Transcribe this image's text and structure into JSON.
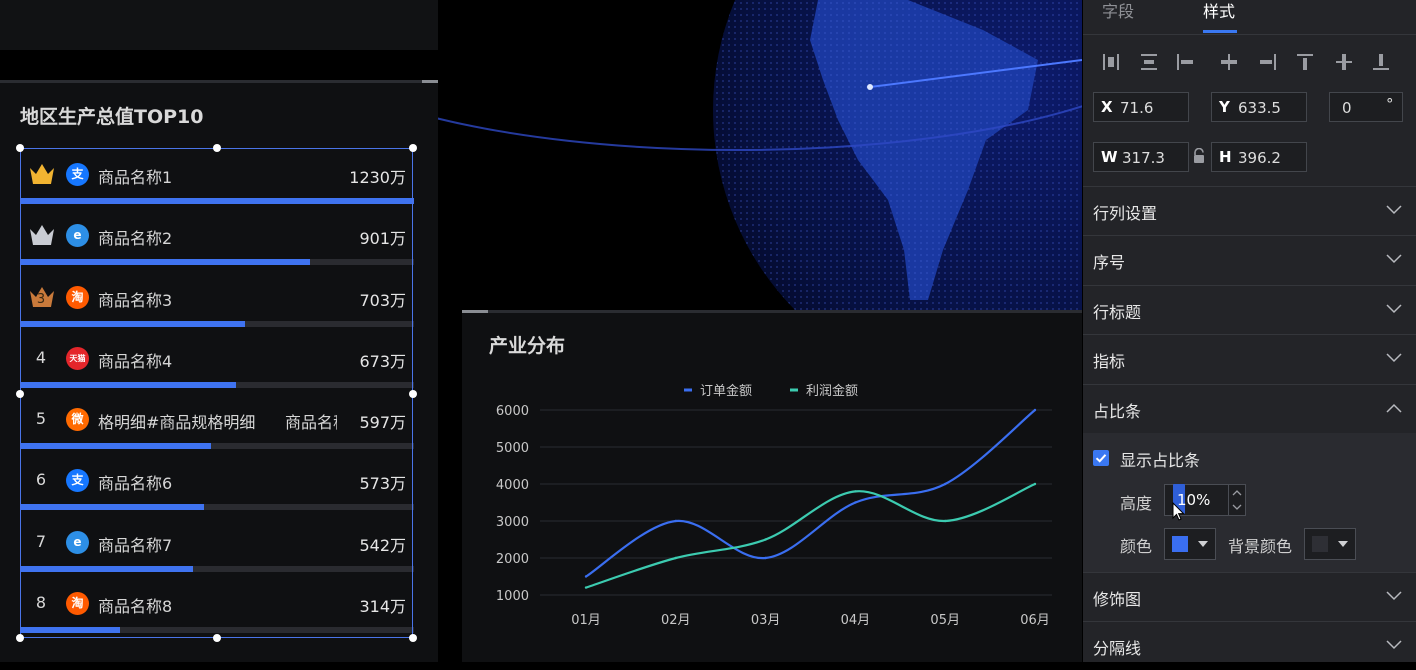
{
  "rank_panel": {
    "title": "地区生产总值TOP10",
    "rows": [
      {
        "rank": "",
        "icon": "alipay-icon",
        "icon_text": "支",
        "icon_color": "#1677ff",
        "crown": "gold",
        "name": "商品名称1",
        "extra": "",
        "value": "1230万",
        "ratio": 1.0
      },
      {
        "rank": "",
        "icon": "ie-icon",
        "icon_text": "e",
        "icon_color": "#2d8fe6",
        "crown": "silver",
        "name": "商品名称2",
        "extra": "",
        "value": "901万",
        "ratio": 0.735
      },
      {
        "rank": "3",
        "icon": "taobao-icon",
        "icon_text": "淘",
        "icon_color": "#ff5a00",
        "crown": "bronze",
        "name": "商品名称3",
        "extra": "",
        "value": "703万",
        "ratio": 0.572
      },
      {
        "rank": "4",
        "icon": "tmall-icon",
        "icon_text": "天猫",
        "icon_color": "#e4262b",
        "crown": "",
        "name": "商品名称4",
        "extra": "",
        "value": "673万",
        "ratio": 0.547
      },
      {
        "rank": "5",
        "icon": "weibo-icon",
        "icon_text": "微",
        "icon_color": "#ff6a00",
        "crown": "",
        "name": "格明细#商品规格明细",
        "extra": "商品名称",
        "value": "597万",
        "ratio": 0.486
      },
      {
        "rank": "6",
        "icon": "alipay-icon",
        "icon_text": "支",
        "icon_color": "#1677ff",
        "crown": "",
        "name": "商品名称6",
        "extra": "",
        "value": "573万",
        "ratio": 0.466
      },
      {
        "rank": "7",
        "icon": "ie-icon",
        "icon_text": "e",
        "icon_color": "#2d8fe6",
        "crown": "",
        "name": "商品名称7",
        "extra": "",
        "value": "542万",
        "ratio": 0.44
      },
      {
        "rank": "8",
        "icon": "taobao-icon",
        "icon_text": "淘",
        "icon_color": "#ff5a00",
        "crown": "",
        "name": "商品名称8",
        "extra": "",
        "value": "314万",
        "ratio": 0.255
      }
    ]
  },
  "chart_panel": {
    "title": "产业分布"
  },
  "chart_data": {
    "type": "line",
    "categories": [
      "01月",
      "02月",
      "03月",
      "04月",
      "05月",
      "06月"
    ],
    "series": [
      {
        "name": "订单金额",
        "color": "#3a6ef0",
        "values": [
          1500,
          3000,
          2000,
          3500,
          4000,
          6000
        ]
      },
      {
        "name": "利润金额",
        "color": "#3ccbb0",
        "values": [
          1200,
          2000,
          2500,
          3800,
          3000,
          4000
        ]
      }
    ],
    "y_ticks": [
      "6000",
      "5000",
      "4000",
      "3000",
      "2000",
      "1000"
    ],
    "ylim": [
      1000,
      6000
    ],
    "legend": "top-center",
    "grid": true,
    "title": "",
    "xlabel": "",
    "ylabel": ""
  },
  "props": {
    "tabs": [
      "字段",
      "样式"
    ],
    "active_tab": "样式",
    "x_label": "X",
    "x_value": "71.6",
    "y_label": "Y",
    "y_value": "633.5",
    "rotation_value": "0",
    "rotation_unit": "°",
    "w_label": "W",
    "w_value": "317.3",
    "h_label": "H",
    "h_value": "396.2",
    "sections": [
      "行列设置",
      "序号",
      "行标题",
      "指标",
      "占比条",
      "修饰图",
      "分隔线"
    ],
    "ratio_bar": {
      "show_label": "显示占比条",
      "show_checked": true,
      "height_label": "高度",
      "height_value": "10%",
      "color_label": "颜色",
      "color_value": "#3a6ef0",
      "bg_color_label": "背景颜色",
      "bg_color_value": "#2e2f35"
    }
  }
}
